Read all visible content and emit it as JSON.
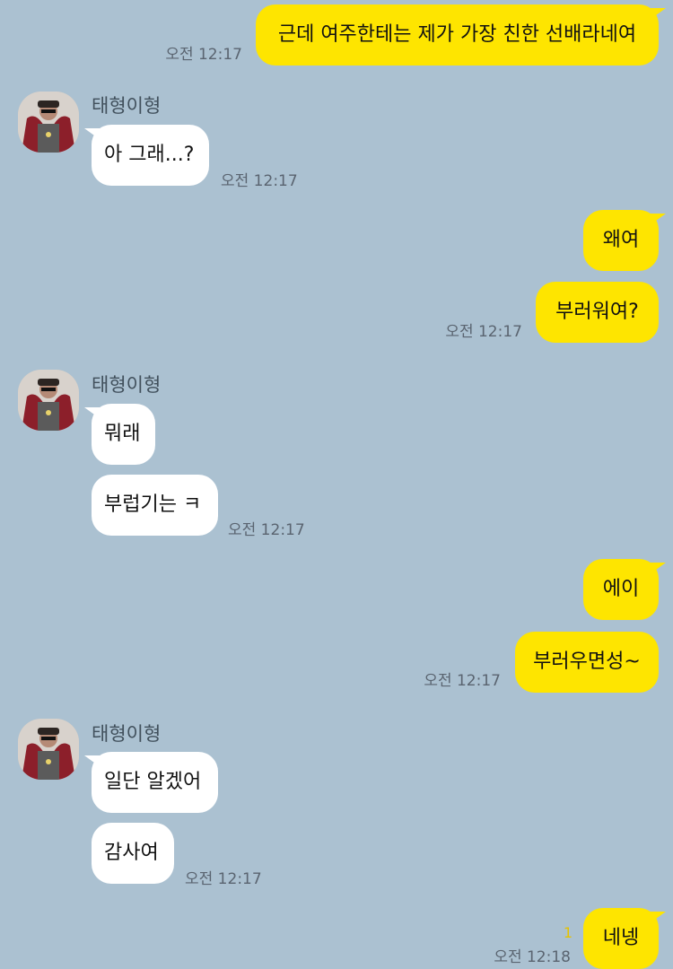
{
  "chat": {
    "contact_name": "태형이형",
    "messages": [
      {
        "text": "근데 여주한테는 제가 가장 친한 선배라네여",
        "time": "오전 12:17"
      },
      {
        "text": "아 그래...?",
        "time": "오전 12:17"
      },
      {
        "text": "왜여"
      },
      {
        "text": "부러워여?",
        "time": "오전 12:17"
      },
      {
        "text": "뭐래"
      },
      {
        "text": "부럽기는 ㅋ",
        "time": "오전 12:17"
      },
      {
        "text": "에이"
      },
      {
        "text": "부러우면성~",
        "time": "오전 12:17"
      },
      {
        "text": "일단 알겠어"
      },
      {
        "text": "감사여",
        "time": "오전 12:17"
      },
      {
        "text": "네넹",
        "time": "오전 12:18",
        "unread": "1"
      }
    ]
  },
  "colors": {
    "background": "#abc1d1",
    "outgoing_bubble": "#fee500",
    "incoming_bubble": "#ffffff",
    "unread_count": "#e6c200"
  }
}
